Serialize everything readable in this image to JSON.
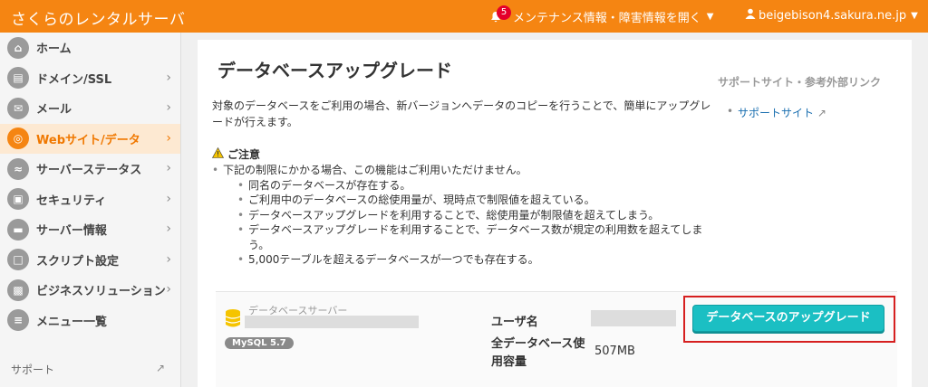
{
  "header": {
    "logo": "さくらのレンタルサーバ",
    "notification_count": "5",
    "maintenance_label": "メンテナンス情報・障害情報を開く",
    "user": "beigebison4.sakura.ne.jp"
  },
  "sidebar": {
    "items": [
      {
        "label": "ホーム",
        "icon": "home-icon",
        "active": false
      },
      {
        "label": "ドメイン/SSL",
        "icon": "domain-icon",
        "active": false
      },
      {
        "label": "メール",
        "icon": "mail-icon",
        "active": false
      },
      {
        "label": "Webサイト/データ",
        "icon": "globe-icon",
        "active": true
      },
      {
        "label": "サーバーステータス",
        "icon": "chart-icon",
        "active": false
      },
      {
        "label": "セキュリティ",
        "icon": "lock-icon",
        "active": false
      },
      {
        "label": "サーバー情報",
        "icon": "server-icon",
        "active": false
      },
      {
        "label": "スクリプト設定",
        "icon": "script-icon",
        "active": false
      },
      {
        "label": "ビジネスソリューション",
        "icon": "business-icon",
        "active": false
      },
      {
        "label": "メニュー一覧",
        "icon": "menu-list-icon",
        "active": false
      }
    ],
    "support_label": "サポート"
  },
  "main": {
    "title": "データベースアップグレード",
    "description": "対象のデータベースをご利用の場合、新バージョンへデータのコピーを行うことで、簡単にアップグレードが行えます。",
    "caution_title": "ご注意",
    "caution_intro": "下記の制限にかかる場合、この機能はご利用いただけません。",
    "caution_items": [
      "同名のデータベースが存在する。",
      "ご利用中のデータベースの総使用量が、現時点で制限値を超えている。",
      "データベースアップグレードを利用することで、総使用量が制限値を超えてしまう。",
      "データベースアップグレードを利用することで、データベース数が規定の利用数を超えてしまう。",
      "5,000テーブルを超えるデータベースが一つでも存在する。"
    ],
    "links_heading": "サポートサイト・参考外部リンク",
    "support_link": "サポートサイト",
    "db": {
      "server_label": "データベースサーバー",
      "version_badge": "MySQL 5.7",
      "user_label": "ユーザ名",
      "total_label": "全データベース使用容量",
      "total_value": "507MB",
      "upgrade_button": "データベースのアップグレード"
    }
  },
  "colors": {
    "brand": "#f58512",
    "accent_button": "#1bbfc3",
    "highlight_frame": "#d62020"
  }
}
